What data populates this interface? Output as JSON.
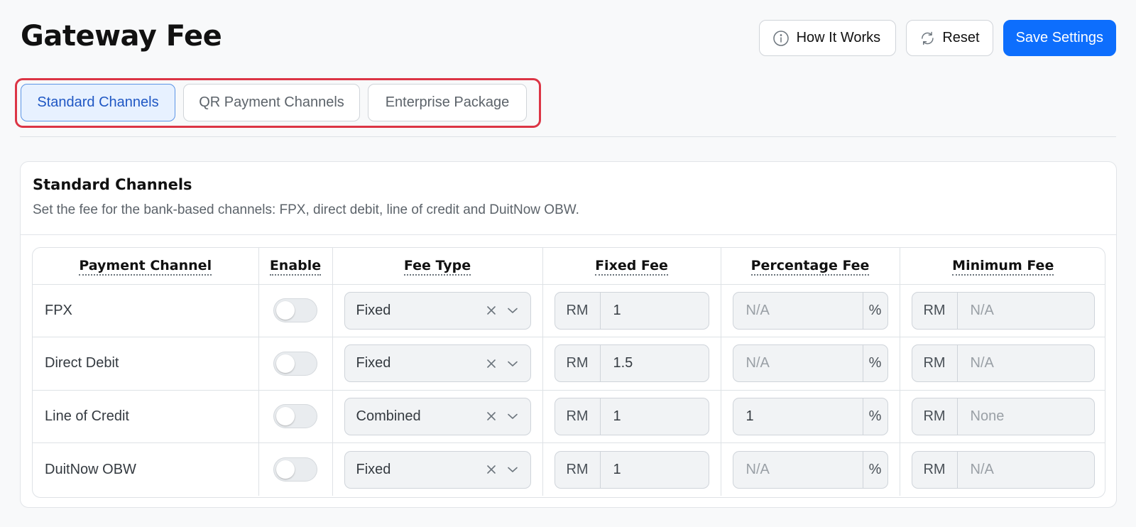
{
  "header": {
    "title": "Gateway Fee",
    "how_it_works": "How It Works",
    "reset": "Reset",
    "save": "Save Settings"
  },
  "tabs": [
    {
      "label": "Standard Channels",
      "active": true
    },
    {
      "label": "QR Payment Channels",
      "active": false
    },
    {
      "label": "Enterprise Package",
      "active": false
    }
  ],
  "card": {
    "title": "Standard Channels",
    "description": "Set the fee for the bank-based channels: FPX, direct debit, line of credit and DuitNow OBW."
  },
  "table": {
    "columns": [
      "Payment Channel",
      "Enable",
      "Fee Type",
      "Fixed Fee",
      "Percentage Fee",
      "Minimum Fee"
    ],
    "currency": "RM",
    "percent_sign": "%",
    "rows": [
      {
        "channel": "FPX",
        "enabled": false,
        "fee_type": "Fixed",
        "fixed_fee": "1",
        "fixed_placeholder": "",
        "pct_fee": "",
        "pct_placeholder": "N/A",
        "min_fee": "",
        "min_placeholder": "N/A"
      },
      {
        "channel": "Direct Debit",
        "enabled": false,
        "fee_type": "Fixed",
        "fixed_fee": "1.5",
        "fixed_placeholder": "",
        "pct_fee": "",
        "pct_placeholder": "N/A",
        "min_fee": "",
        "min_placeholder": "N/A"
      },
      {
        "channel": "Line of Credit",
        "enabled": false,
        "fee_type": "Combined",
        "fixed_fee": "1",
        "fixed_placeholder": "",
        "pct_fee": "1",
        "pct_placeholder": "",
        "min_fee": "",
        "min_placeholder": "None"
      },
      {
        "channel": "DuitNow OBW",
        "enabled": false,
        "fee_type": "Fixed",
        "fixed_fee": "1",
        "fixed_placeholder": "",
        "pct_fee": "",
        "pct_placeholder": "N/A",
        "min_fee": "",
        "min_placeholder": "N/A"
      }
    ]
  }
}
